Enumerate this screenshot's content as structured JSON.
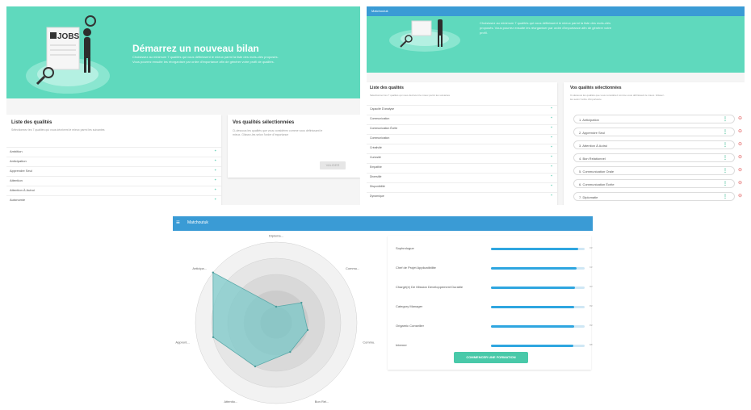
{
  "screen1": {
    "hero": {
      "title": "Démarrez un nouveau bilan",
      "subtitle": "Choisissez au minimum 7 qualités qui vous définissent le mieux parmi la liste des mots-clés proposés. Vous pourrez ensuite les réorganiser par ordre d'importance afin de générer votre profil de qualités.",
      "illustration_text": "JOBS"
    },
    "list_card": {
      "title": "Liste des qualités",
      "subtitle": "Sélectionnez les 7 qualités qui vous décrivent le mieux parmi les suivantes",
      "items": [
        "Ambition",
        "Anticipation",
        "Apprendre Seul",
        "Attention",
        "Attention À Autrui",
        "Autonomie"
      ]
    },
    "selected_card": {
      "title": "Vos qualités sélectionnées",
      "subtitle": "Ci-dessous les qualités que vous considérez comme vous définissant le mieux. Glissez-les selon l'ordre d'importance",
      "button_label": "VALIDER"
    }
  },
  "screen2": {
    "appbar_title": "Matchoutuk",
    "hero_subtitle": "Choisissez au minimum 7 qualités qui vous définissent le mieux parmi la liste des mots-clés proposés. Vous pourrez ensuite les réorganiser par ordre d'importance afin de générer votre profil.",
    "list_card": {
      "title": "Liste des qualités",
      "subtitle": "Sélectionnez les 7 qualités qui vous décrivent le mieux parmi les suivantes",
      "items": [
        "Capacité D'analyse",
        "Communication",
        "Communication Écrite",
        "Communication",
        "Créativité",
        "Curiosité",
        "Empathie",
        "Diversifié",
        "Disponibilité",
        "Dynamique"
      ]
    },
    "selected_card": {
      "title": "Vos qualités sélectionnées",
      "subtitle": "Ci-dessous les qualités que vous considérez comme vous définissant le mieux. Glissez-les selon l'ordre d'importance",
      "items": [
        "1. Anticipation",
        "2. Apprendre Seul",
        "3. Attention À Autrui",
        "4. Bon Relationnel",
        "5. Communication Orale",
        "6. Communication Écrite",
        "7. Diplomatie"
      ]
    }
  },
  "screen3": {
    "appbar_title": "Matchoutuk",
    "radar_labels": [
      "Diploma...",
      "Commu...",
      "Commu...",
      "Bon Rel...",
      "Attentio...",
      "Apprent...",
      "Anticipa..."
    ],
    "jobs": [
      {
        "label": "Sophrologue",
        "value": 0.93,
        "pct": "93%"
      },
      {
        "label": "Chef de Projet Applicatibilite",
        "value": 0.91,
        "pct": "91%"
      },
      {
        "label": "Chargé(e) De Mission Developpement Durable",
        "value": 0.9,
        "pct": "90%"
      },
      {
        "label": "Category Manager",
        "value": 0.89,
        "pct": "89%"
      },
      {
        "label": "Origamic Conseiller",
        "value": 0.89,
        "pct": "89%"
      },
      {
        "label": "Interner",
        "value": 0.88,
        "pct": "88%"
      }
    ],
    "cta_label": "COMMENCER UNE FORMATION",
    "chart_data": {
      "type": "radar",
      "categories": [
        "Diploma...",
        "Commu...",
        "Commu...",
        "Bon Rel...",
        "Attentio...",
        "Apprent...",
        "Anticipa..."
      ],
      "values": [
        1,
        2,
        2,
        2,
        3,
        4,
        5
      ],
      "max": 5,
      "colors": {
        "fill": "#7cc9c9",
        "rings": "#d6d6d6"
      }
    }
  },
  "colors": {
    "mint": "#5fd9bd",
    "blue": "#3a9bd5",
    "accent": "#49c9a9"
  }
}
